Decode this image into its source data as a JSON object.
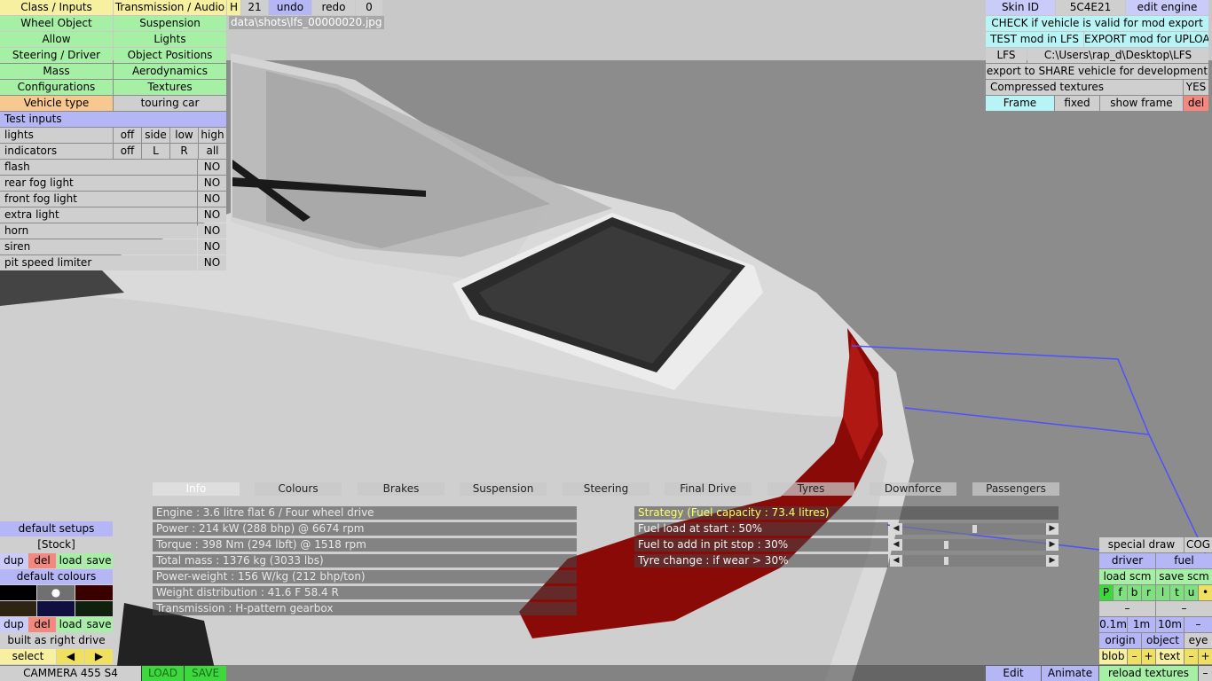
{
  "left_menu": {
    "rows": [
      [
        "Class / Inputs",
        "Transmission / Audio"
      ],
      [
        "Wheel Object",
        "Suspension"
      ],
      [
        "Allow",
        "Lights"
      ],
      [
        "Steering / Driver",
        "Object Positions"
      ],
      [
        "Mass",
        "Aerodynamics"
      ],
      [
        "Configurations",
        "Textures"
      ]
    ],
    "vehicle_type_label": "Vehicle type",
    "vehicle_type_value": "touring car"
  },
  "top_toolbar": {
    "h": "H",
    "num": "21",
    "undo": "undo",
    "redo": "redo",
    "zero": "0",
    "screenshot_path": "data\\shots\\lfs_00000020.jpg"
  },
  "test_inputs": {
    "header": "Test inputs",
    "lights": {
      "label": "lights",
      "options": [
        "off",
        "side",
        "low",
        "high"
      ]
    },
    "indicators": {
      "label": "indicators",
      "options": [
        "off",
        "L",
        "R",
        "all"
      ]
    },
    "toggles": [
      {
        "label": "flash",
        "value": "NO"
      },
      {
        "label": "rear fog light",
        "value": "NO"
      },
      {
        "label": "front fog light",
        "value": "NO"
      },
      {
        "label": "extra light",
        "value": "NO"
      },
      {
        "label": "horn",
        "value": "NO"
      },
      {
        "label": "siren",
        "value": "NO"
      },
      {
        "label": "pit speed limiter",
        "value": "NO"
      }
    ]
  },
  "right_panel": {
    "skin_id_label": "Skin ID",
    "skin_id_value": "5C4E21",
    "edit_engine": "edit engine",
    "check": "CHECK if vehicle is valid for mod export",
    "test_mod": "TEST mod in LFS",
    "export_mod": "EXPORT mod for UPLOAD",
    "lfs": "LFS",
    "lfs_path": "C:\\Users\\rap_d\\Desktop\\LFS",
    "export_share": "export to SHARE vehicle for development",
    "compressed_label": "Compressed textures",
    "compressed_value": "YES",
    "frame": "Frame",
    "fixed": "fixed",
    "show_frame": "show frame",
    "del": "del"
  },
  "info_tabs": [
    "Info",
    "Colours",
    "Brakes",
    "Suspension",
    "Steering",
    "Final Drive",
    "Tyres",
    "Downforce",
    "Passengers"
  ],
  "info_lines": [
    "Engine : 3.6 litre flat 6 / Four wheel drive",
    "Power : 214 kW (288 bhp) @ 6674 rpm",
    "Torque : 398 Nm (294 lbft) @ 1518 rpm",
    "Total mass : 1376 kg (3033 lbs)",
    "Power-weight : 156 W/kg (212 bhp/ton)",
    "Weight distribution : 41.6 F  58.4 R",
    "Transmission : H-pattern gearbox"
  ],
  "strategy": {
    "title": "Strategy (Fuel capacity : 73.4 litres)",
    "rows": [
      {
        "label": "Fuel load at start : 50%",
        "fraction": 0.5
      },
      {
        "label": "Fuel to add in pit stop : 30%",
        "fraction": 0.3
      },
      {
        "label": "Tyre change : if wear > 30%",
        "fraction": 0.3
      }
    ]
  },
  "bottom_left": {
    "default_setups": "default setups",
    "stock": "[Stock]",
    "dup": "dup",
    "del": "del",
    "load": "load",
    "save": "save",
    "default_colours": "default colours",
    "swatch_colors": [
      "#000000",
      "#707070",
      "#3a0000",
      "#2e2414",
      "#101040",
      "#0f200f"
    ],
    "built_as": "built as right drive",
    "select": "select",
    "left_arrow": "◀",
    "right_arrow": "▶"
  },
  "status_bar": {
    "car_name": "CAMMERA 455 S4",
    "load": "LOAD",
    "save": "SAVE",
    "edit": "Edit",
    "animate": "Animate"
  },
  "bottom_right": {
    "special_draw": "special draw",
    "cog": "COG",
    "driver": "driver",
    "fuel": "fuel",
    "load_scm": "load scm",
    "save_scm": "save scm",
    "letters": [
      "P",
      "f",
      "b",
      "r",
      "l",
      "t",
      "u",
      "•"
    ],
    "minus": "–",
    "dist": [
      "0.1m",
      "1m",
      "10m",
      "–"
    ],
    "origin": "origin",
    "object": "object",
    "eye": "eye",
    "blob": "blob",
    "text": "text",
    "plus": "+",
    "dash": "–",
    "reload_textures": "reload textures"
  },
  "colors": {
    "sky": "#c5c5c5",
    "car_body": "#dcdcdc",
    "tail_light": "#8a0a08"
  }
}
